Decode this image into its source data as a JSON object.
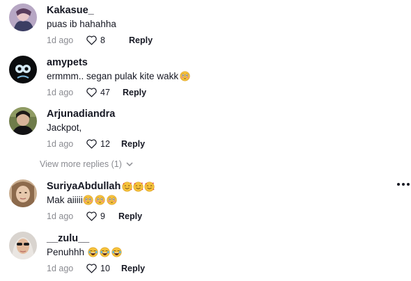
{
  "comments": [
    {
      "username": "Kakasue_",
      "text": "puas ib hahahha",
      "time": "1d ago",
      "likes": "8",
      "reply_label": "Reply",
      "emojis": []
    },
    {
      "username": "amypets",
      "text": "ermmm.. segan pulak kite wakk",
      "time": "1d ago",
      "likes": "47",
      "reply_label": "Reply",
      "emojis": [
        "flushed-face"
      ]
    },
    {
      "username": "Arjunadiandra",
      "text": "Jackpot,",
      "time": "1d ago",
      "likes": "12",
      "reply_label": "Reply",
      "emojis": []
    },
    {
      "username": "SuriyaAbdullah",
      "text": "Mak aiiiii",
      "time": "1d ago",
      "likes": "9",
      "reply_label": "Reply",
      "username_emojis": [
        "smiling-face-with-hearts",
        "smiling-face-with-hearts",
        "smiling-face-with-hearts"
      ],
      "emojis": [
        "flushed-face",
        "flushed-face",
        "flushed-face"
      ]
    },
    {
      "username": "__zulu__",
      "text": "Penuhhh ",
      "time": "1d ago",
      "likes": "10",
      "reply_label": "Reply",
      "emojis": [
        "tears-of-joy",
        "tears-of-joy",
        "tears-of-joy"
      ]
    }
  ],
  "view_more_replies": "View more replies (1)",
  "icons": {
    "like": "heart-outline-icon",
    "more": "more-horizontal-icon",
    "chevron": "chevron-down-icon"
  }
}
